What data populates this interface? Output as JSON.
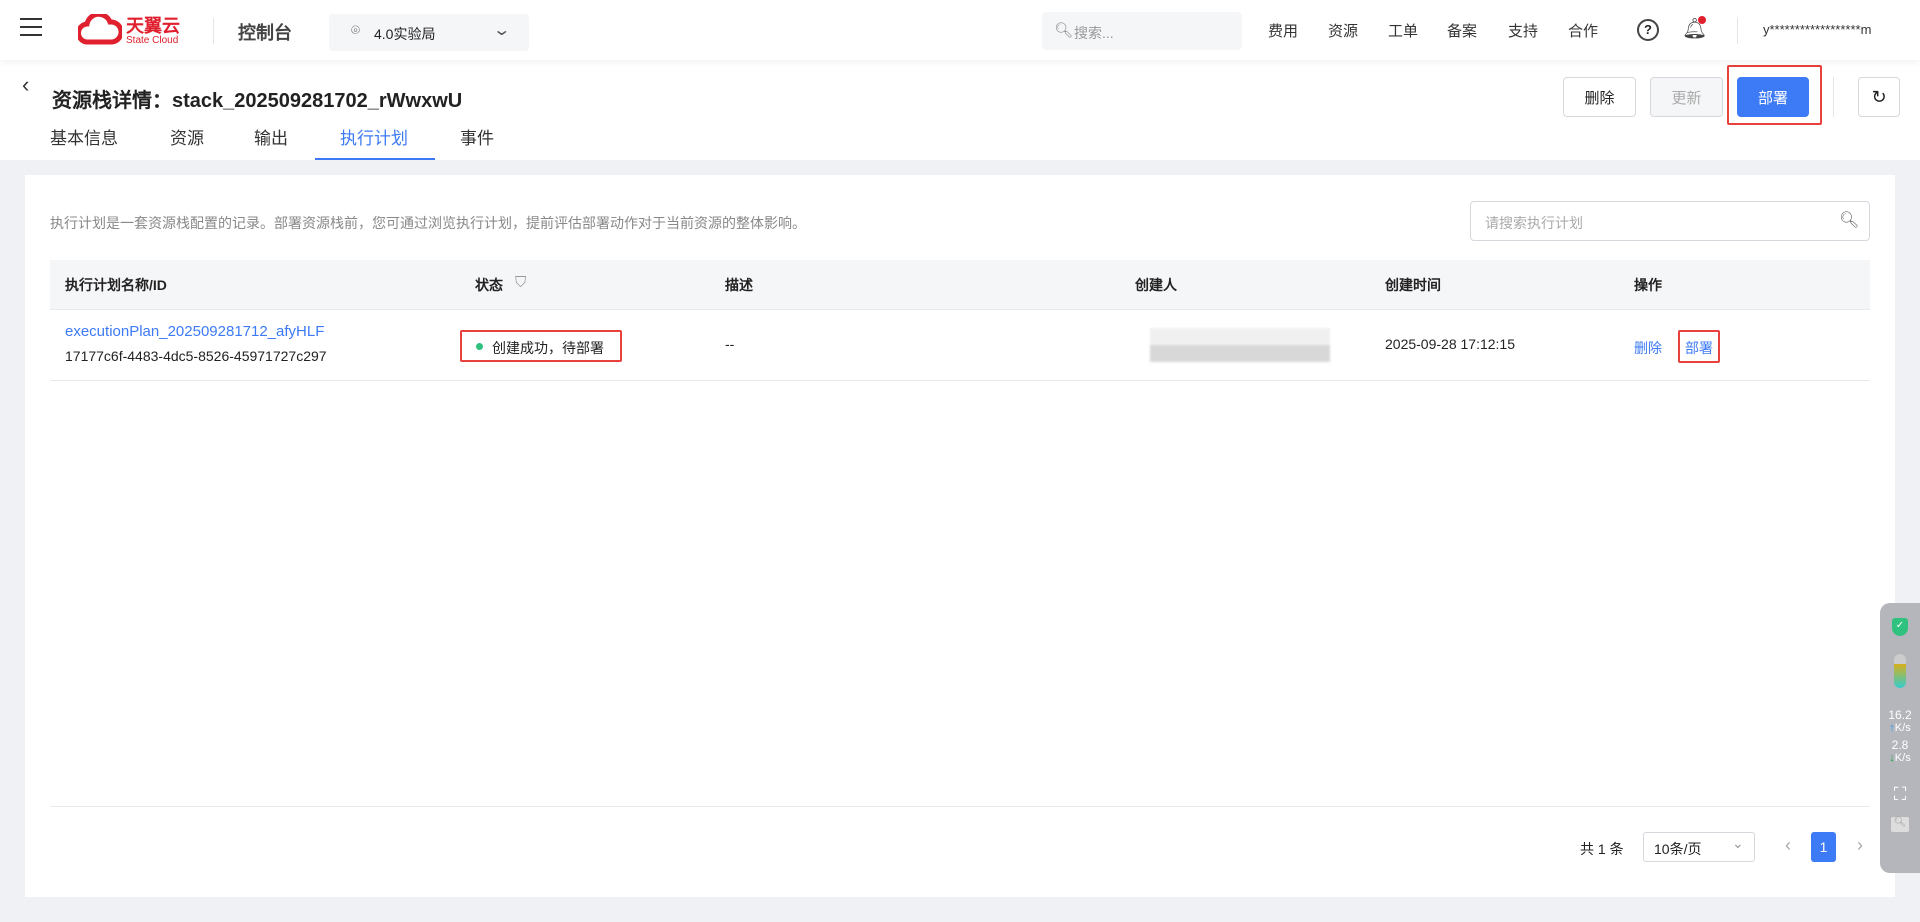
{
  "topnav": {
    "brand_cn": "天翼云",
    "brand_en": "State Cloud",
    "console": "控制台",
    "region": "4.0实验局",
    "search_placeholder": "搜索...",
    "links": [
      "费用",
      "资源",
      "工单",
      "备案",
      "支持",
      "合作"
    ],
    "username": "y******************m",
    "accent": "#3d7af5"
  },
  "header": {
    "title": "资源栈详情：stack_202509281702_rWwxwU",
    "buttons": {
      "delete": "删除",
      "update": "更新",
      "deploy": "部署"
    },
    "tabs": [
      "基本信息",
      "资源",
      "输出",
      "执行计划",
      "事件"
    ],
    "active_tab": "执行计划"
  },
  "main": {
    "description": "执行计划是一套资源栈配置的记录。部署资源栈前，您可通过浏览执行计划，提前评估部署动作对于当前资源的整体影响。",
    "search_placeholder": "请搜索执行计划",
    "table": {
      "columns": [
        "执行计划名称/ID",
        "状态",
        "描述",
        "创建人",
        "创建时间",
        "操作"
      ],
      "rows": [
        {
          "name": "executionPlan_202509281712_afyHLF",
          "id": "17177c6f-4483-4dc5-8526-45971727c297",
          "status": "创建成功，待部署",
          "description": "--",
          "created_at": "2025-09-28 17:12:15",
          "actions": [
            "删除",
            "部署"
          ]
        }
      ]
    },
    "pagination": {
      "total": "共 1 条",
      "page_size": "10条/页",
      "current_page": "1"
    }
  },
  "side_widget": {
    "up_speed": "16.2",
    "up_unit": "K/s",
    "down_speed": "2.8",
    "down_unit": "K/s"
  }
}
